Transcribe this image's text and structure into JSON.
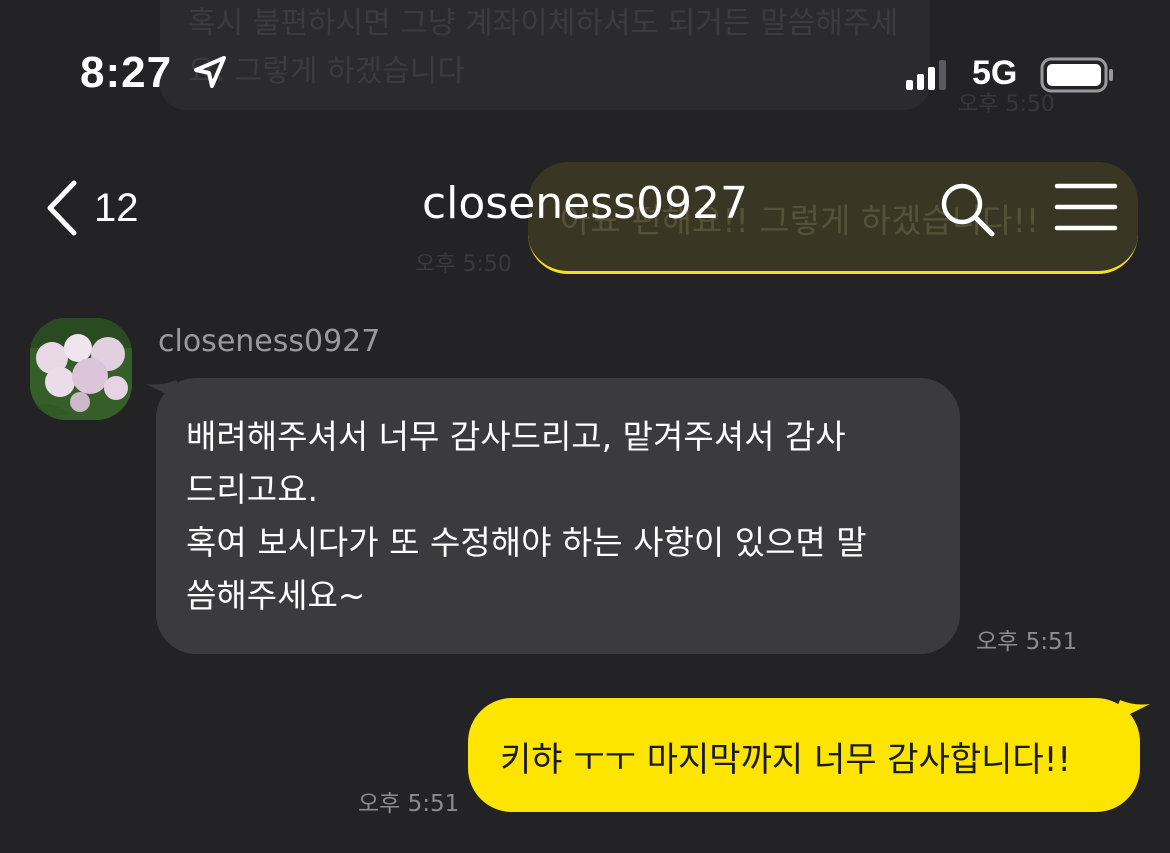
{
  "status_bar": {
    "time": "8:27",
    "network": "5G",
    "icons": [
      "location-arrow-icon",
      "signal-bars-icon",
      "battery-icon"
    ]
  },
  "nav": {
    "back_count": "12",
    "title": "closeness0927",
    "icons": [
      "chevron-left-icon",
      "search-icon",
      "menu-icon"
    ]
  },
  "background_messages": {
    "partial_text": "혹시 불편하시면 그냥 계좌이체하셔도 되거든 말씀해주세요. 그렇게 하겠습니다",
    "yellow_partial_text": "아뇨 편해요!! 그렇게 하겠습니다!!",
    "time_top": "오후 5:50",
    "time_mid": "오후 5:50"
  },
  "messages": [
    {
      "direction": "incoming",
      "sender": "closeness0927",
      "text": "배려해주셔서 너무 감사드리고, 맡겨주셔서 감사\n드리고요.\n혹여 보시다가 또 수정해야 하는 사항이 있으면 말\n씀해주세요~",
      "time": "오후 5:51"
    },
    {
      "direction": "outgoing",
      "text": "키햐 ㅜㅜ 마지막까지 너무 감사합니다!!",
      "time": "오후 5:51"
    }
  ],
  "colors": {
    "background": "#232325",
    "incoming_bubble": "#3b3b3e",
    "outgoing_bubble": "#fee500",
    "timestamp": "#8c8c90"
  }
}
